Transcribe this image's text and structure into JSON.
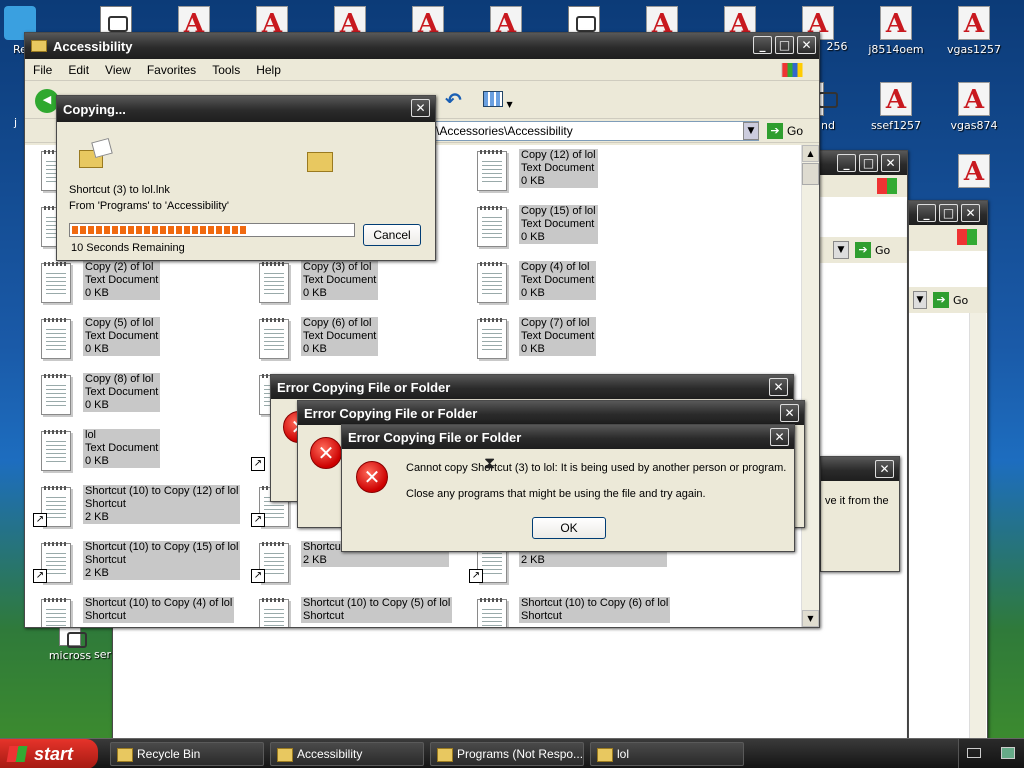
{
  "desktop": {
    "icons_top": [
      {
        "label": "Re",
        "type": "doc"
      },
      {
        "label": "",
        "type": "doc"
      },
      {
        "label": "",
        "type": "pdf"
      },
      {
        "label": "",
        "type": "pdf"
      },
      {
        "label": "",
        "type": "pdf"
      },
      {
        "label": "",
        "type": "pdf"
      },
      {
        "label": "",
        "type": "doc"
      },
      {
        "label": "",
        "type": "pdf"
      },
      {
        "label": "",
        "type": "pdf"
      },
      {
        "label": "256",
        "type": "pdf"
      },
      {
        "label": "j8514oem",
        "type": "pdf"
      },
      {
        "label": "vgas1257",
        "type": "pdf"
      }
    ],
    "icons_row2": [
      {
        "label": "nd"
      },
      {
        "label": "ssef1257"
      },
      {
        "label": "vgas874"
      }
    ],
    "bottom_icons": [
      {
        "label": "micross"
      },
      {
        "label": "ser"
      }
    ],
    "left_edge_text": "j"
  },
  "explorer": {
    "title": "Accessibility",
    "menu": [
      "File",
      "Edit",
      "View",
      "Favorites",
      "Tools",
      "Help"
    ],
    "address": "\\Accessories\\Accessibility",
    "go_label": "Go",
    "files": [
      {
        "name": "Copy (12) of lol",
        "type": "Text Document",
        "size": "0 KB",
        "shortcut": false
      },
      {
        "name": "Copy (15) of lol",
        "type": "Text Document",
        "size": "0 KB",
        "shortcut": false
      },
      {
        "name": "Copy (2) of lol",
        "type": "Text Document",
        "size": "0 KB",
        "shortcut": false
      },
      {
        "name": "Copy (3) of lol",
        "type": "Text Document",
        "size": "0 KB",
        "shortcut": false
      },
      {
        "name": "Copy (4) of lol",
        "type": "Text Document",
        "size": "0 KB",
        "shortcut": false
      },
      {
        "name": "Copy (5) of lol",
        "type": "Text Document",
        "size": "0 KB",
        "shortcut": false
      },
      {
        "name": "Copy (6) of lol",
        "type": "Text Document",
        "size": "0 KB",
        "shortcut": false
      },
      {
        "name": "Copy (7) of lol",
        "type": "Text Document",
        "size": "0 KB",
        "shortcut": false
      },
      {
        "name": "Copy (8) of lol",
        "type": "Text Document",
        "size": "0 KB",
        "shortcut": false
      },
      {
        "name": "lol",
        "type": "Text Document",
        "size": "0 KB",
        "shortcut": false
      },
      {
        "name": "Shortcut (10) to Copy (12) of lol",
        "type": "Shortcut",
        "size": "2 KB",
        "shortcut": true
      },
      {
        "name": "Shortcut (10) to Copy (15) of lol",
        "type": "Shortcut",
        "size": "2 KB",
        "shortcut": true
      },
      {
        "name": "Shortcut",
        "type": "",
        "size": "2 KB",
        "shortcut": true
      },
      {
        "name": "Shortcut",
        "type": "",
        "size": "2 KB",
        "shortcut": true
      },
      {
        "name": "Shortcut (10) to Copy (4) of lol",
        "type": "Shortcut",
        "size": "",
        "shortcut": false
      },
      {
        "name": "Shortcut (10) to Copy (5) of lol",
        "type": "Shortcut",
        "size": "",
        "shortcut": false
      },
      {
        "name": "Shortcut (10) to Copy (6) of lol",
        "type": "Shortcut",
        "size": "",
        "shortcut": false
      }
    ]
  },
  "copying": {
    "title": "Copying...",
    "file": "Shortcut (3) to lol.lnk",
    "from_to": "From 'Programs' to 'Accessibility'",
    "progress": 0.62,
    "remaining": "10 Seconds Remaining",
    "cancel_label": "Cancel"
  },
  "errors": {
    "title": "Error Copying File or Folder",
    "message": "Cannot copy Shortcut (3) to lol: It is being used by another person or program.",
    "hint": "Close any programs that might be using the file and try again.",
    "ok_label": "OK"
  },
  "bg_window": {
    "go_label": "Go",
    "snippet": "ve it from the"
  },
  "taskbar": {
    "start_label": "start",
    "tasks": [
      "Recycle Bin",
      "Accessibility",
      "Programs (Not Respo...",
      "lol"
    ]
  },
  "colors": {
    "title_dark": "#2b2b2b",
    "progress": "#f06a10",
    "go_green": "#2f9e2f"
  }
}
